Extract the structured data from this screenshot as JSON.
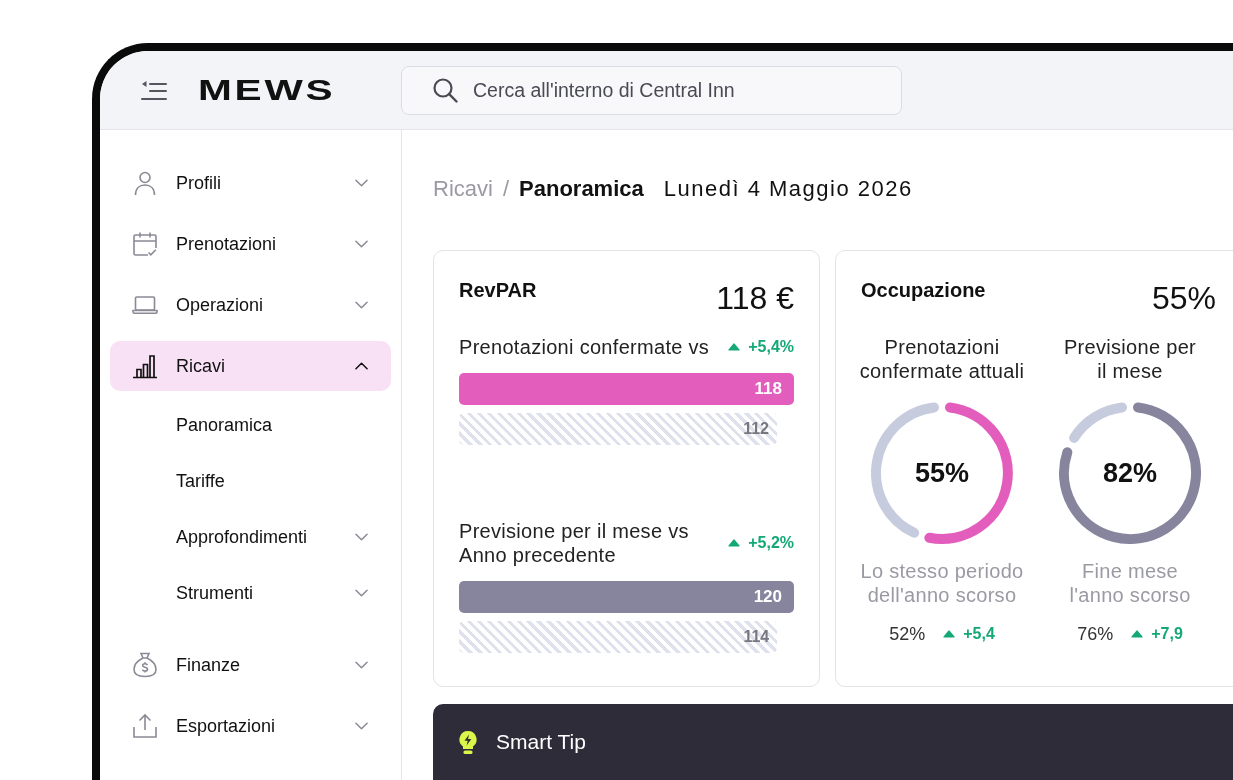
{
  "top_bar": {
    "logo": "MEWS",
    "search": {
      "placeholder": "Cerca all'interno di Central Inn"
    }
  },
  "sidebar": {
    "items": [
      {
        "label": "Profili",
        "selected": false,
        "expanded": false
      },
      {
        "label": "Prenotazioni",
        "selected": false,
        "expanded": false
      },
      {
        "label": "Operazioni",
        "selected": false,
        "expanded": false
      },
      {
        "label": "Ricavi",
        "selected": true,
        "expanded": true,
        "children": [
          {
            "label": "Panoramica",
            "kind": "link",
            "selected": false
          },
          {
            "label": "Tariffe",
            "kind": "link",
            "selected": false
          },
          {
            "label": "Approfondimenti",
            "kind": "group",
            "selected": false,
            "expanded": false
          },
          {
            "label": "Strumenti",
            "kind": "group",
            "selected": false,
            "expanded": false
          }
        ]
      },
      {
        "label": "Finanze",
        "selected": false,
        "expanded": false
      },
      {
        "label": "Esportazioni",
        "selected": false,
        "expanded": false
      }
    ]
  },
  "header": {
    "breadcrumb": [
      {
        "label": "Ricavi",
        "current": false
      },
      {
        "label": "Panoramica",
        "current": true
      }
    ],
    "separator": "/",
    "date": "Lunedì 4 Maggio 2026"
  },
  "revpar": {
    "title": "RevPAR",
    "value": "118 €",
    "comparisons": [
      {
        "label": "Prenotazioni confermate vs",
        "delta": "+5,4%",
        "bars": [
          {
            "kind": "current",
            "value": "118",
            "color": "#e35dbc"
          },
          {
            "kind": "previous",
            "value": "112"
          }
        ]
      },
      {
        "label": "Previsione per il mese vs Anno precedente",
        "delta": "+5,2%",
        "bars": [
          {
            "kind": "current",
            "value": "120",
            "color": "#87849d"
          },
          {
            "kind": "previous",
            "value": "114"
          }
        ]
      }
    ]
  },
  "occupancy": {
    "title": "Occupazione",
    "value": "55%",
    "gauges": [
      {
        "label": "Prenotazioni confermate attuali",
        "color": "#e35dbc",
        "center": "55%",
        "comparison_label": "Lo stesso periodo dell'anno scorso",
        "comparison_value": "52%",
        "delta": "+5,4"
      },
      {
        "label": "Previsione per il mese",
        "color": "#87849d",
        "center": "82%",
        "comparison_label": "Fine mese l'anno scorso",
        "comparison_value": "76%",
        "delta": "+7,9"
      }
    ]
  },
  "smart_tip": {
    "title": "Smart Tip"
  }
}
